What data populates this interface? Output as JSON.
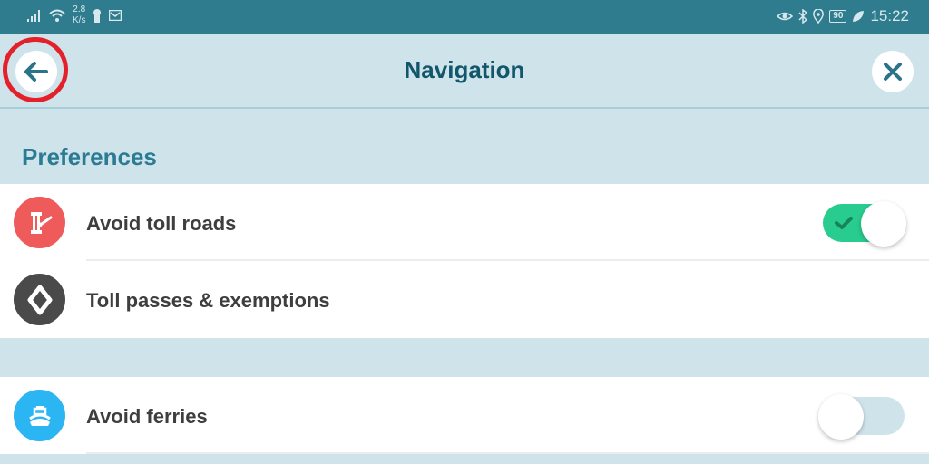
{
  "status_bar": {
    "left_icons": [
      "signal-icon",
      "wifi-icon",
      "keyhole-icon",
      "mail-icon"
    ],
    "speed_value": "2.8",
    "speed_unit": "K/s",
    "right_icons": [
      "eye-icon",
      "bluetooth-icon",
      "location-icon",
      "battery-icon",
      "leaf-icon"
    ],
    "battery": "90",
    "time": "15:22"
  },
  "header": {
    "title": "Navigation",
    "back_icon": "arrow-left-icon",
    "close_icon": "close-icon"
  },
  "section": {
    "title": "Preferences"
  },
  "items": [
    {
      "label": "Avoid toll roads",
      "icon": "toll-gate-icon",
      "icon_color": "#ef5a5a",
      "toggle": true,
      "on": true
    },
    {
      "label": "Toll passes & exemptions",
      "icon": "diamond-icon",
      "icon_color": "#4a4a4a",
      "toggle": false
    },
    {
      "label": "Avoid ferries",
      "icon": "ferry-icon",
      "icon_color": "#2bb5f2",
      "toggle": true,
      "on": false
    }
  ],
  "colors": {
    "accent": "#12566b",
    "toggle_on": "#28cc8e",
    "toggle_off": "#cfe3ea",
    "highlight_ring": "#e4202a"
  }
}
